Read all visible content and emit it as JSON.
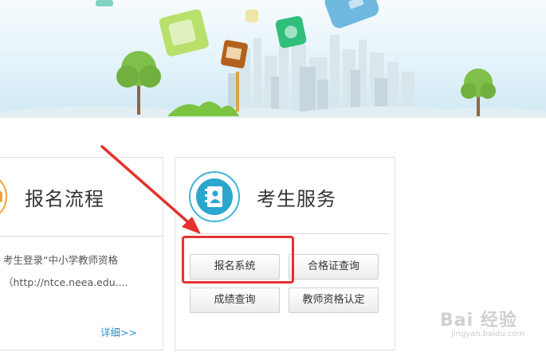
{
  "left_card": {
    "title": "报名流程",
    "description_line1": "考生登录“中小学教师资格",
    "description_line2": "（http://ntce.neea.edu....",
    "more_link": "详细>>"
  },
  "right_card": {
    "title": "考生服务",
    "icon": "address-book-icon",
    "buttons": {
      "registration": "报名系统",
      "certificate_query": "合格证查询",
      "score_query": "成绩查询",
      "qualification": "教师资格认定"
    }
  },
  "annotation": {
    "highlight_color": "#e5322d",
    "arrow_color": "#e5322d"
  },
  "watermark": {
    "text": "Bai 经验",
    "url": "jingyan.baidu.com"
  },
  "colors": {
    "accent": "#2aa6cf",
    "link": "#2a8fd0",
    "orange_icon": "#f2a33a"
  }
}
